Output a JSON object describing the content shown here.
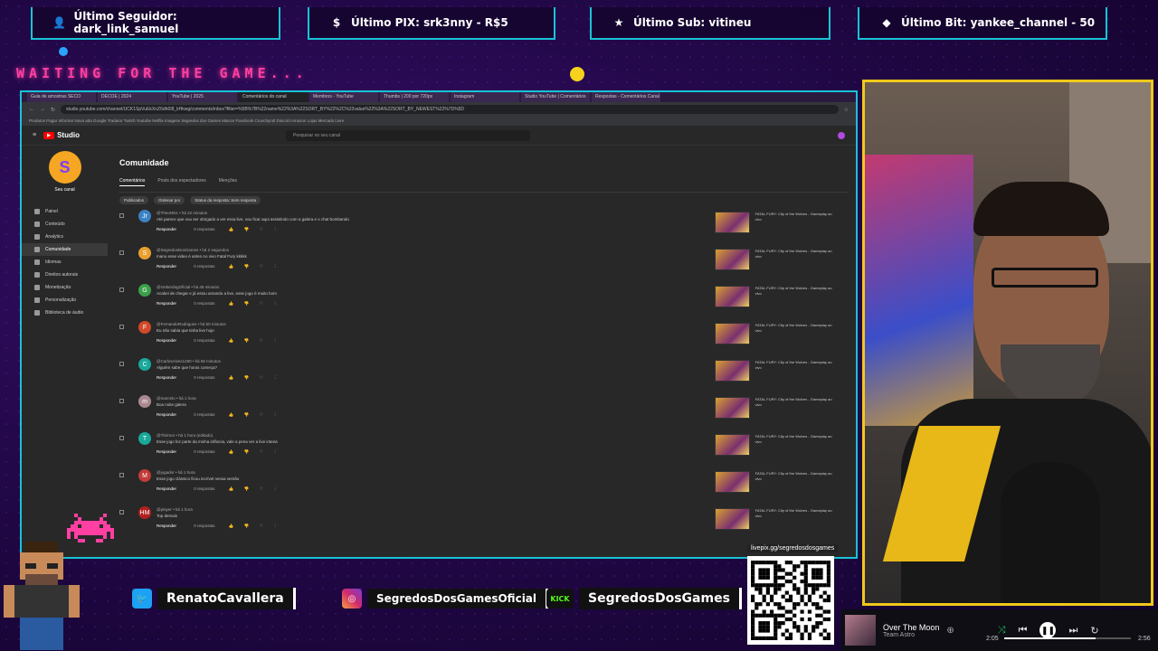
{
  "alerts": [
    {
      "label": "Último Seguidor: dark_link_samuel",
      "icon": "person-icon",
      "color": "#19c3d6"
    },
    {
      "label": "Último PIX: srk3nny - R$5",
      "icon": "dollar-icon",
      "color": "#19c3d6"
    },
    {
      "label": "Último Sub: vitineu",
      "icon": "star-icon",
      "color": "#19c3d6"
    },
    {
      "label": "Último Bit: yankee_channel - 50",
      "icon": "diamond-icon",
      "color": "#19c3d6"
    }
  ],
  "waiting": "WAITING FOR THE GAME...",
  "browser": {
    "tabs": [
      "Guia de amostras SECO",
      "DECOE | 2024",
      "YouTube | 2025",
      "Comentários do canal",
      "Membros - YouTube",
      "Thumbs | 200 por 720px",
      "Instagram",
      "Studio YouTube | Comentários",
      "Respostas - Comentários Canal"
    ],
    "url": "studio.youtube.com/channel/UCK1SpVuEkXnZ6dh6I8_kHkwg/comments/inbox?filter=%5B%7B%22name%22%3A%22SORT_BY%22%2C%22value%22%3A%22SORT_BY_NEWEST%22%7D%5D",
    "bookmarks": "Produtos  Pagar  Informar  Nova aba  Google  Tradutor  Twitch  Youtube  Netflix  Imagens  Segredos dos Games  Marcar  Facebook  Crunchyroll  Discord  Amazon  Lojas  Mercado Livre"
  },
  "studio": {
    "logo": "Studio",
    "search_placeholder": "Pesquisar no seu canal",
    "channel_name": "Seu canal",
    "nav": [
      "Painel",
      "Conteúdo",
      "Analytics",
      "Comunidade",
      "Idiomas",
      "Direitos autorais",
      "Monetização",
      "Personalização",
      "Biblioteca de áudio"
    ],
    "page_title": "Comunidade",
    "tabs": [
      "Comentários",
      "Posts dos espectadores",
      "Menções"
    ],
    "chips": [
      "Publicados",
      "Ordenar por",
      "Status da resposta: Sem resposta"
    ],
    "reply_label": "Responder",
    "responses_label": "0 respostas",
    "comments": [
      {
        "author": "@TheoNN1 • há 22 minutos",
        "text": "Até parece que vou ser obrigado a ver essa live, vou ficar aqui assistindo com a galera e o chat bombando",
        "initial": "Jr",
        "color": "#3b82c4"
      },
      {
        "author": "@SegredosDosGames • há 2 segundos",
        "text": "mano esse video é antes Ao vivo Fatal Fury kkkkk",
        "initial": "S",
        "color": "#e8a030"
      },
      {
        "author": "@GeberdogOficial • há 45 minutos",
        "text": "Acabei de chegar e já estou amando a live, esse jogo é muito bom",
        "initial": "G",
        "color": "#3ca04a"
      },
      {
        "author": "@FernandoRodrigues • há 50 minutos",
        "text": "Eu não sabia que tinha live hoje",
        "initial": "F",
        "color": "#d04a2a"
      },
      {
        "author": "@CarlosAlves1490 • há 55 minutos",
        "text": "Alguém sabe que horas começa?",
        "initial": "C",
        "color": "#19a89a"
      },
      {
        "author": "@marcelo • há 1 hora",
        "text": "Boa noite galera",
        "initial": "m",
        "color": "#aa8890"
      },
      {
        "author": "@Tbirmor • há 1 hora (editado)",
        "text": "Esse jogo fez parte da minha infância, vale a pena ver a live inteira",
        "initial": "T",
        "color": "#19a89a"
      },
      {
        "author": "@jogador • há 1 hora",
        "text": "Esse jogo clássico ficou incrível nessa versão",
        "initial": "M",
        "color": "#c43a3a"
      },
      {
        "author": "@player • há 1 hora",
        "text": "Top demais",
        "initial": "HM",
        "color": "#b02020"
      }
    ],
    "video_title": "FATAL FURY: City of the Wolves - Gameplay ao vivo"
  },
  "social": [
    {
      "name": "RenatoCavallera",
      "icon": "twitter-icon"
    },
    {
      "name": "SegredosDosGamesOficial",
      "icon": "instagram-icon"
    },
    {
      "name": "SegredosDosGames",
      "icon": "kick-icon"
    }
  ],
  "qr_label": "livepix.gg/segredosdosgames",
  "player": {
    "title": "Over The Moon",
    "artist": "Team Astro",
    "elapsed": "2:05",
    "total": "2:56",
    "progress": 0.72
  }
}
